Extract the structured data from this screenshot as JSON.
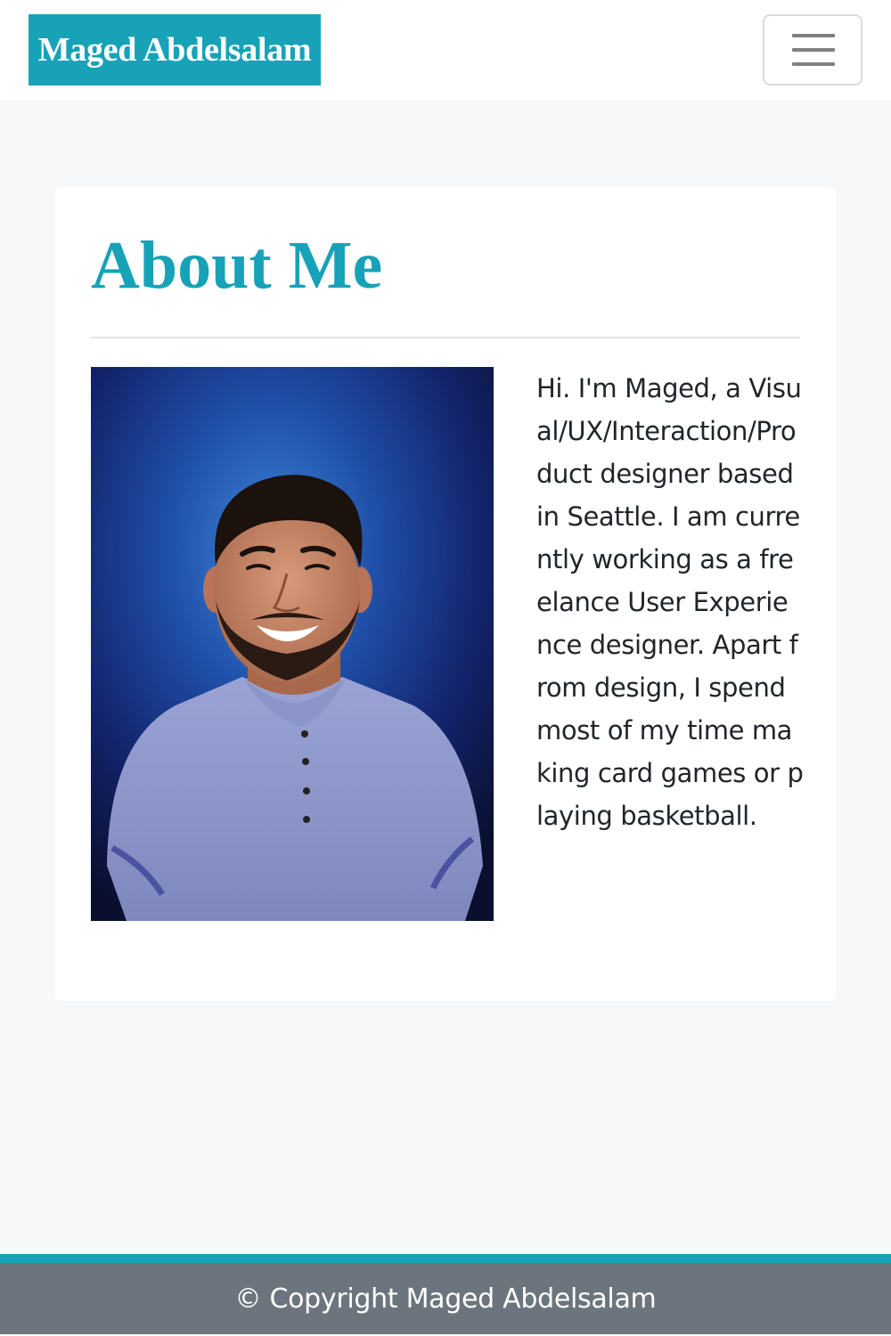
{
  "navbar": {
    "brand": "Maged Abdelsalam",
    "toggler_icon": "hamburger-menu-icon"
  },
  "about": {
    "title": "About Me",
    "photo_description": "portrait-photo",
    "bio": "Hi. I'm Maged, a Visual/UX/Interaction/Product designer based in Seattle. I am currently working as a freelance User Experience designer. Apart from design, I spend most of my time making card games or playing basketball."
  },
  "footer": {
    "copyright": "© Copyright Maged Abdelsalam"
  },
  "colors": {
    "accent": "#17a2b8",
    "footer_bg": "#6c757d",
    "page_bg": "#f7f8fa"
  }
}
